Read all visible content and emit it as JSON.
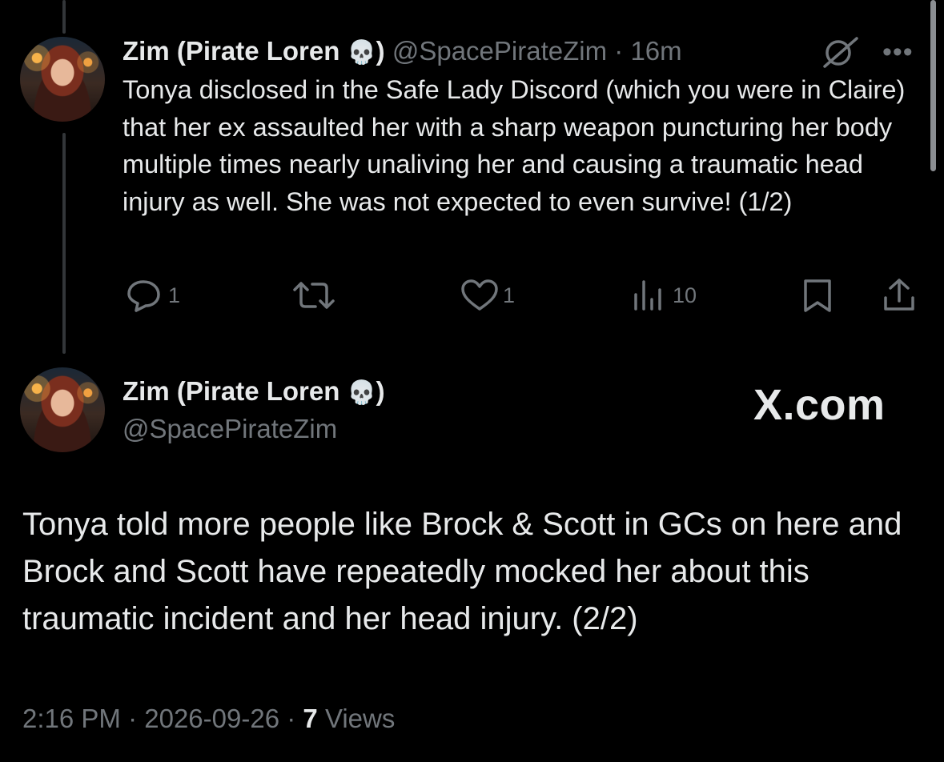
{
  "tweet1": {
    "author_name": "Zim (Pirate Loren",
    "author_emoji": "💀",
    "author_close": ")",
    "handle": "@SpacePirateZim",
    "separator": "·",
    "time_ago": "16m",
    "more": "•••",
    "text": "Tonya disclosed in the Safe Lady Discord (which you were in Claire) that her ex assaulted her with a sharp weapon puncturing her body multiple times nearly unaliving her and causing a traumatic head injury as well. She was not expected to even survive! (1/2)",
    "actions": {
      "replies": "1",
      "retweets": "",
      "likes": "1",
      "views": "10"
    }
  },
  "tweet2": {
    "author_name": "Zim (Pirate Loren",
    "author_emoji": "💀",
    "author_close": ")",
    "handle": "@SpacePirateZim",
    "watermark": "X.com",
    "text": "Tonya told more people like Brock & Scott in GCs on here and Brock and Scott have repeatedly mocked her about this traumatic incident and her head injury. (2/2)",
    "time": "2:16 PM",
    "separator": "·",
    "date": "2026-09-26",
    "views_count": "7",
    "views_label": "Views"
  },
  "icons": {
    "reply": "reply-icon",
    "retweet": "retweet-icon",
    "like": "heart-icon",
    "views": "views-icon",
    "bookmark": "bookmark-icon",
    "share": "share-icon",
    "grok": "grok-icon",
    "more": "more-icon"
  },
  "colors": {
    "background": "#000000",
    "text": "#e7e9ea",
    "muted": "#71767b",
    "thread_line": "#333639"
  }
}
